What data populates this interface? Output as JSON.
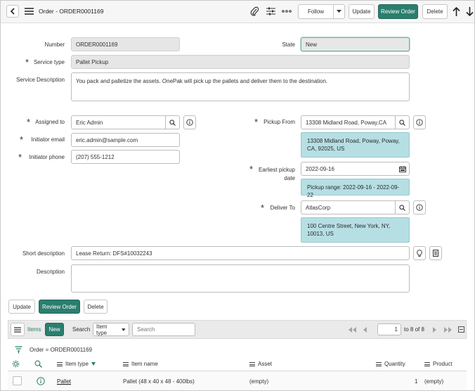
{
  "header": {
    "title": "Order - ORDER0001169",
    "buttons": {
      "follow": "Follow",
      "update": "Update",
      "review_order": "Review Order",
      "delete": "Delete"
    }
  },
  "form": {
    "number": {
      "label": "Number",
      "value": "ORDER0001169"
    },
    "state": {
      "label": "State",
      "value": "New"
    },
    "service_type": {
      "label": "Service type",
      "value": "Pallet Pickup"
    },
    "service_description": {
      "label": "Service Description",
      "value": "You pack and palletize the assets.  OnePak will pick up the pallets and deliver them to the destination."
    },
    "assigned_to": {
      "label": "Assigned to",
      "value": "Eric Admin"
    },
    "initiator_email": {
      "label": "Initiator email",
      "value": "eric.admin@sample.com"
    },
    "initiator_phone": {
      "label": "Initiator phone",
      "value": "(207) 555-1212"
    },
    "pickup_from": {
      "label": "Pickup From",
      "value": "13308 Midland Road, Poway,CA",
      "info": "13308 Midland Road, Poway, Poway, CA, 92025, US"
    },
    "earliest_pickup": {
      "label_line1": "Earliest pickup",
      "label_line2": "date",
      "value": "2022-09-16",
      "info": "Pickup range: 2022-09-16 - 2022-09-22"
    },
    "deliver_to": {
      "label": "Deliver To",
      "value": "AtlasCorp",
      "info": "100 Centre Street, New York, NY, 10013, US"
    },
    "short_description": {
      "label": "Short description",
      "value": "Lease Return: DFS#10032243"
    },
    "description": {
      "label": "Description",
      "value": ""
    },
    "bottom_buttons": {
      "update": "Update",
      "review_order": "Review Order",
      "delete": "Delete"
    }
  },
  "related_list": {
    "tab_label": "Items",
    "new_label": "New",
    "search_label": "Search",
    "search_field": "Item type",
    "search_placeholder": "Search",
    "page_value": "1",
    "page_range": "to 8 of 8",
    "breadcrumb": "Order = ORDER0001169",
    "columns": {
      "item_type": "Item type",
      "item_name": "Item name",
      "asset": "Asset",
      "quantity": "Quantity",
      "product": "Product"
    },
    "rows": [
      {
        "item_type": "Pallet",
        "item_name": "Pallet (48 x 40 x 48 - 400lbs)",
        "asset": "(empty)",
        "quantity": "1",
        "product": "(empty)"
      }
    ]
  },
  "colors": {
    "primary": "#2b7e6d",
    "info_bg": "#b6dfe4",
    "readonly_bg": "#e6e6e6"
  },
  "icons": [
    "back-icon",
    "menu-icon",
    "paperclip-icon",
    "sliders-icon",
    "more-icon",
    "chevron-down-icon",
    "arrow-up-icon",
    "arrow-down-icon",
    "search-icon",
    "info-icon",
    "calendar-icon",
    "lightbulb-icon",
    "document-icon",
    "filter-icon",
    "gear-icon",
    "first-page-icon",
    "prev-page-icon",
    "next-page-icon",
    "last-page-icon",
    "collapse-icon"
  ]
}
